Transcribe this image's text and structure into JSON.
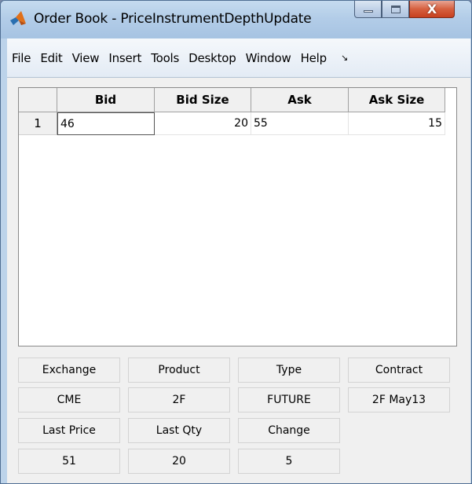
{
  "window": {
    "title": "Order Book - PriceInstrumentDepthUpdate",
    "close_glyph": "X"
  },
  "menu": {
    "items": [
      "File",
      "Edit",
      "View",
      "Insert",
      "Tools",
      "Desktop",
      "Window",
      "Help"
    ],
    "overflow_glyph": "↘"
  },
  "table": {
    "columns": [
      "Bid",
      "Bid Size",
      "Ask",
      "Ask Size"
    ],
    "rows": [
      {
        "row_label": "1",
        "bid": "46",
        "bid_size": "20",
        "ask": "55",
        "ask_size": "15"
      }
    ]
  },
  "info": {
    "labels": {
      "exchange": "Exchange",
      "product": "Product",
      "type": "Type",
      "contract": "Contract",
      "last_price": "Last Price",
      "last_qty": "Last Qty",
      "change": "Change"
    },
    "values": {
      "exchange": "CME",
      "product": "2F",
      "type": "FUTURE",
      "contract": "2F May13",
      "last_price": "51",
      "last_qty": "20",
      "change": "5"
    }
  }
}
